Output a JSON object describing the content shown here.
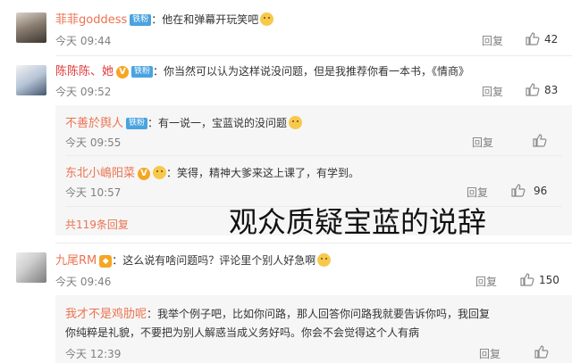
{
  "reply_label": "回复",
  "comments": [
    {
      "name": "菲菲goddess",
      "badge": "铁粉",
      "text": "：他在和弹幕开玩笑吧",
      "time": "今天 09:44",
      "likes": "42"
    },
    {
      "name": "陈陈陈、她",
      "badge": "铁粉",
      "verified": "V",
      "text": "：你当然可以认为这样说没问题，但是我推荐你看一本书，《情商》",
      "time": "今天 09:52",
      "likes": "83",
      "replies": [
        {
          "name": "不善於舆人",
          "badge": "铁粉",
          "text": "：有一说一，宝蓝说的没问题",
          "time": "今天 09:55",
          "likes": ""
        },
        {
          "name": "东北小嶋阳菜",
          "verified": "V",
          "text": "：笑得，精神大爹来这上课了，有学到。",
          "time": "今天 10:57",
          "likes": "96"
        }
      ],
      "more_replies": "共119条回复"
    },
    {
      "name": "九尾RM",
      "text": "：这么说有啥问题吗？评论里个别人好急啊",
      "time": "今天 09:46",
      "likes": "150",
      "replies": [
        {
          "name": "我才不是鸡肋呢",
          "text_line1": "：我举个例子吧，比如你问路，那人回答你问路我就要告诉你吗，我回复",
          "text_line2": "你纯粹是礼貌，不要把为别人解惑当成义务好吗。你会不会觉得这个人有病",
          "time": "今天 12:39",
          "likes": ""
        }
      ]
    }
  ],
  "overlay_caption": "观众质疑宝蓝的说辞",
  "icons": {
    "like": "thumbs-up-icon",
    "emoji": "smiley-emoji-icon",
    "verified": "verified-v-badge-icon"
  }
}
